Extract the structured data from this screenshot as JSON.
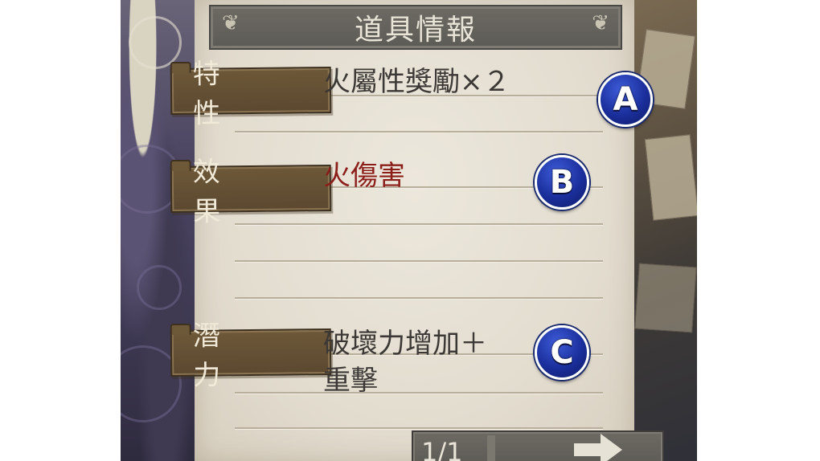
{
  "title": "道具情報",
  "rows": [
    {
      "label": "特　性",
      "value": "火屬性獎勵×２",
      "badge": "A"
    },
    {
      "label": "效　果",
      "value": "火傷害",
      "badge": "B"
    },
    {
      "label": "潛　力",
      "value_line1": "破壞力增加＋",
      "value_line2": "重擊",
      "badge": "C"
    }
  ],
  "pager": {
    "text": "1/1"
  },
  "colors": {
    "effect_text": "#8c1e1a",
    "badge": "#1b2f9c",
    "tag": "#5b4830"
  }
}
